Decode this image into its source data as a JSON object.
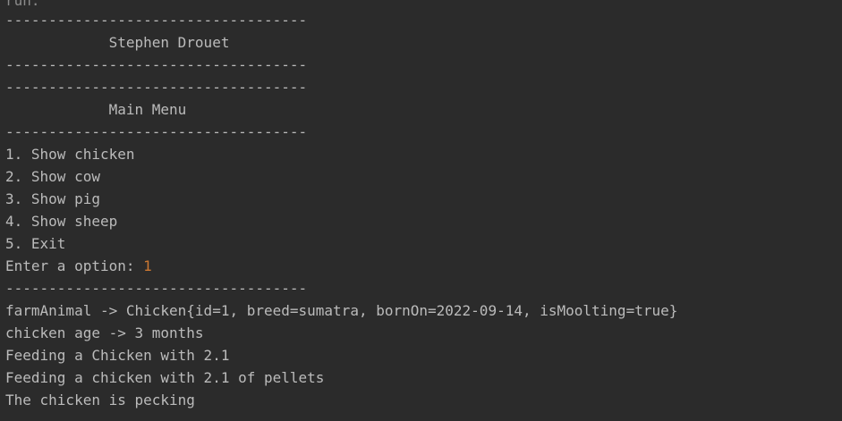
{
  "console": {
    "clipped_top": "run:",
    "lines": [
      "-----------------------------------",
      "            Stephen Drouet",
      "-----------------------------------",
      "-----------------------------------",
      "            Main Menu",
      "-----------------------------------",
      "1. Show chicken",
      "2. Show cow",
      "3. Show pig",
      "4. Show sheep",
      "5. Exit",
      "Enter a option: ",
      "-----------------------------------",
      "farmAnimal -> Chicken{id=1, breed=sumatra, bornOn=2022-09-14, isMoolting=true}",
      "chicken age -> 3 months",
      "Feeding a Chicken with 2.1",
      "Feeding a chicken with 2.1 of pellets",
      "The chicken is pecking"
    ],
    "user_input": "1"
  },
  "colors": {
    "background": "#2b2b2b",
    "text": "#bbbbbb",
    "user_input": "#cc7832"
  }
}
